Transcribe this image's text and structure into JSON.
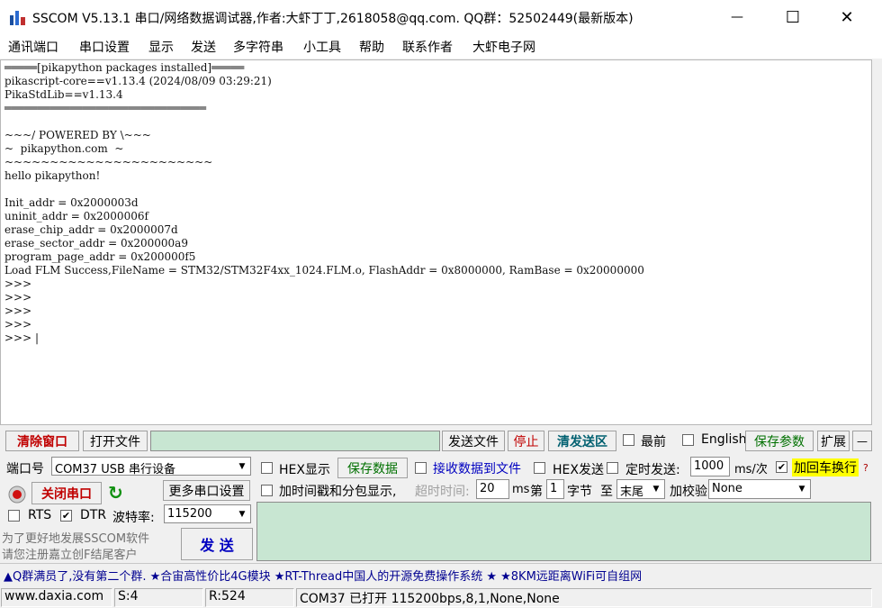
{
  "window": {
    "title": "SSCOM V5.13.1 串口/网络数据调试器,作者:大虾丁丁,2618058@qq.com. QQ群：52502449(最新版本)",
    "minimize_label": "—",
    "maximize_label": "☐",
    "close_label": "✕"
  },
  "menu": [
    "通讯端口",
    "串口设置",
    "显示",
    "发送",
    "多字符串",
    "小工具",
    "帮助",
    "联系作者",
    "大虾电子网"
  ],
  "console": {
    "lines": [
      "═════[pikapython packages installed]═════",
      "pikascript-core==v1.13.4 (2024/08/09 03:29:21)",
      "PikaStdLib==v1.13.4",
      "═══════════════════════════════",
      "",
      "~~~/ POWERED BY \\~~~",
      "~  pikapython.com  ~",
      "~~~~~~~~~~~~~~~~~~~~~~~",
      "hello pikapython!",
      "",
      "Init_addr = 0x2000003d",
      "uninit_addr = 0x2000006f",
      "erase_chip_addr = 0x2000007d",
      "erase_sector_addr = 0x200000a9",
      "program_page_addr = 0x200000f5",
      "Load FLM Success,FileName = STM32/STM32F4xx_1024.FLM.o, FlashAddr = 0x8000000, RamBase = 0x20000000",
      ">>>",
      ">>>",
      ">>>",
      ">>>",
      ">>> |"
    ]
  },
  "toolbar1": {
    "clear_window": "清除窗口",
    "open_file": "打开文件",
    "file_path": "",
    "send_file": "发送文件",
    "stop": "停止",
    "clear_send": "清发送区",
    "topmost": "最前",
    "english": "English",
    "save_params": "保存参数",
    "expand": "扩展",
    "collapse": "—"
  },
  "port": {
    "port_label": "端口号",
    "port_value": "COM37 USB 串行设备",
    "close_port": "关闭串口",
    "more_settings": "更多串口设置",
    "rts": "RTS",
    "dtr": "DTR",
    "rts_checked": false,
    "dtr_checked": true,
    "baud_label": "波特率:",
    "baud_value": "115200"
  },
  "display": {
    "hex_display": "HEX显示",
    "save_data": "保存数据",
    "recv_to_file": "接收数据到文件",
    "hex_send": "HEX发送",
    "timed_send": "定时发送:",
    "interval": "1000",
    "interval_unit": "ms/次",
    "add_crlf": "加回车换行",
    "add_crlf_checked": true,
    "timestamp": "加时间戳和分包显示,",
    "timeout_label": "超时时间:",
    "timeout_value": "20",
    "timeout_unit": "ms",
    "byte_from_label": "第",
    "byte_from_value": "1",
    "byte_unit": "字节",
    "to_label": "至",
    "to_value": "末尾",
    "checksum_label": "加校验",
    "checksum_value": "None"
  },
  "promo": {
    "line1": "为了更好地发展SSCOM软件",
    "line2": "请您注册嘉立创F结尾客户"
  },
  "send_button": "发  送",
  "ticker": "▲Q群满员了,没有第二个群. ★合宙高性价比4G模块 ★RT-Thread中国人的开源免费操作系统 ★ ★8KM远距离WiFi可自组网",
  "status": {
    "site": "www.daxia.com",
    "sent": "S:4",
    "received": "R:524",
    "port_info": "COM37 已打开  115200bps,8,1,None,None"
  },
  "colors": {
    "send_area": "#c8e6d2",
    "accent_red": "#c00000",
    "accent_blue": "#0000c0",
    "highlight": "#ffff00"
  }
}
